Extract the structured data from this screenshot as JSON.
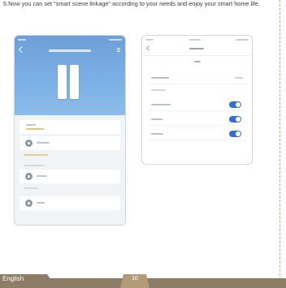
{
  "instruction": {
    "text": "5.Now you can set \"smart scene linkage\" according to your needs and enjoy your smart home life."
  },
  "footer": {
    "language": "English",
    "page_number": "10"
  },
  "colors": {
    "footer_band": "#8d7c66",
    "footer_tab": "#b59a79",
    "toggle_on": "#2f6fd6",
    "app_header": "#7cb1e6"
  },
  "icons": {
    "sensor": "door-window-sensor-icon",
    "toggle": "toggle-switch-icon"
  }
}
